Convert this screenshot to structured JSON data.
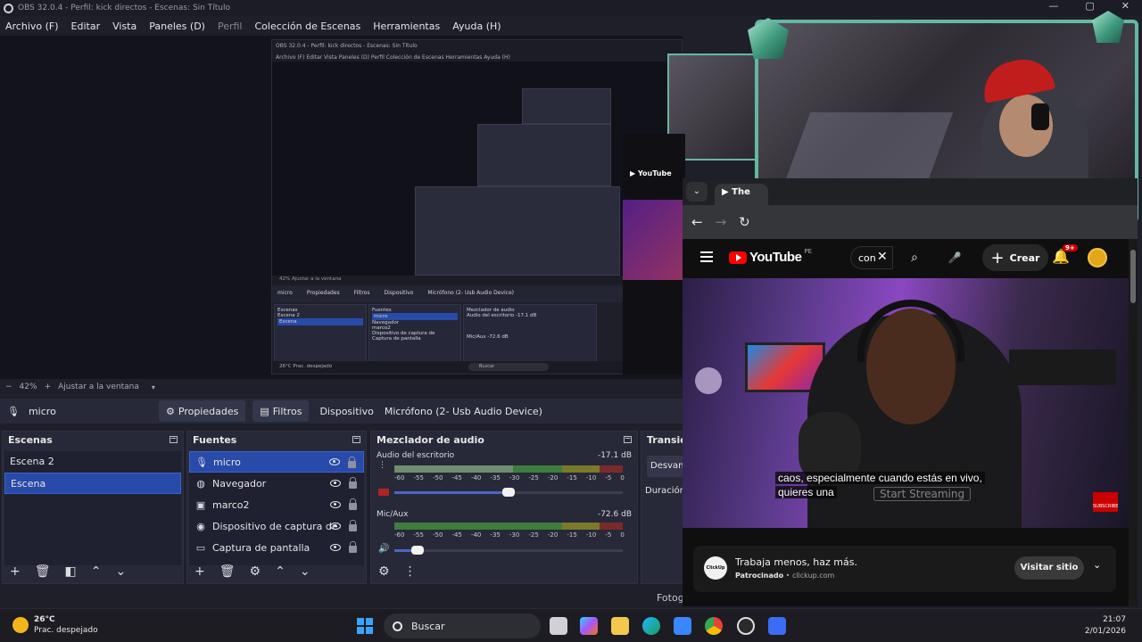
{
  "window": {
    "title": "OBS 32.0.4 - Perfil: kick directos - Escenas: Sin Título",
    "controls": [
      "—",
      "▢",
      "✕"
    ]
  },
  "menu": [
    "Archivo (F)",
    "Editar",
    "Vista",
    "Paneles (D)",
    "Perfil",
    "Colección de Escenas",
    "Herramientas",
    "Ayuda (H)"
  ],
  "nested_obs": {
    "title": "OBS 32.0.4 - Perfil: kick directos - Escenas: Sin Título",
    "menu": "Archivo (F)   Editar   Vista   Paneles (D)   Perfil   Colección de Escenas   Herramientas   Ayuda (H)",
    "zoom": "42%     Ajustar a la ventana",
    "source": "micro",
    "props": "Propiedades",
    "filters": "Filtros",
    "device_label": "Dispositivo",
    "device": "Micrófono (2- Usb Audio Device)",
    "scenes_title": "Escenas",
    "scenes": [
      "Escena 2",
      "Escena"
    ],
    "sources_title": "Fuentes",
    "sources": [
      "micro",
      "Navegador",
      "marco2",
      "Dispositivo de captura de",
      "Captura de pantalla"
    ],
    "mixer_title": "Mezclador de audio",
    "mixer_ch1": "Audio del escritorio",
    "mixer_ch1_db": "-17.1 dB",
    "mixer_ch2": "Mic/Aux",
    "mixer_ch2_db": "-72.6 dB",
    "weather": "26°C Prac. despejado",
    "search": "Buscar"
  },
  "zoombar": {
    "minus": "−",
    "zoom": "42%",
    "plus": "+",
    "fit": "Ajustar a la ventana",
    "caret": "▾"
  },
  "controls": {
    "source_name": "micro",
    "properties": "Propiedades",
    "filters": "Filtros",
    "device_label": "Dispositivo",
    "device_value": "Micrófono (2- Usb Audio Device)"
  },
  "scenes": {
    "title": "Escenas",
    "items": [
      "Escena 2",
      "Escena"
    ],
    "selected": 1
  },
  "sources": {
    "title": "Fuentes",
    "items": [
      {
        "label": "micro",
        "icon": "microphone-icon"
      },
      {
        "label": "Navegador",
        "icon": "globe-icon"
      },
      {
        "label": "marco2",
        "icon": "image-icon"
      },
      {
        "label": "Dispositivo de captura de",
        "icon": "camera-icon"
      },
      {
        "label": "Captura de pantalla",
        "icon": "monitor-icon"
      }
    ],
    "selected": 0
  },
  "mixer": {
    "title": "Mezclador de audio",
    "channels": [
      {
        "name": "Audio del escritorio",
        "db": "-17.1 dB",
        "level": 0.52,
        "volume": 0.5,
        "muted": true
      },
      {
        "name": "Mic/Aux",
        "db": "-72.6 dB",
        "level": 0.0,
        "volume": 0.1,
        "muted": false
      }
    ],
    "ticks": [
      "-60",
      "-55",
      "-50",
      "-45",
      "-40",
      "-35",
      "-30",
      "-25",
      "-20",
      "-15",
      "-10",
      "-5",
      "0"
    ]
  },
  "transitions": {
    "title": "Transici",
    "selected": "Desvan",
    "duration": "Duración"
  },
  "statusbar": {
    "fps": "Fotogr"
  },
  "browser": {
    "tab_title": "The",
    "back": "←",
    "forward": "→",
    "reload": "↻"
  },
  "youtube": {
    "logo": "YouTube",
    "country": "PE",
    "search_text": "con",
    "create": "Crear",
    "badge": "9+",
    "caption_line1": "caos, especialmente cuando estás en vivo,",
    "caption_line2": "quieres una",
    "watermark": "Start Streaming",
    "subscribe": "SUBSCRIBE",
    "ad_title": "Trabaja menos, haz más.",
    "ad_sponsor": "Patrocinado",
    "ad_domain": "clickup.com",
    "ad_logo": "ClickUp",
    "ad_button": "Visitar sitio"
  },
  "taskbar": {
    "temperature": "26°C",
    "weather": "Prac. despejado",
    "search": "Buscar",
    "time": "21:07",
    "date": "2/01/2026"
  },
  "colors": {
    "accent": "#284aa8",
    "youtube_red": "#ff0000",
    "webcam_frame": "#64b8a0"
  }
}
